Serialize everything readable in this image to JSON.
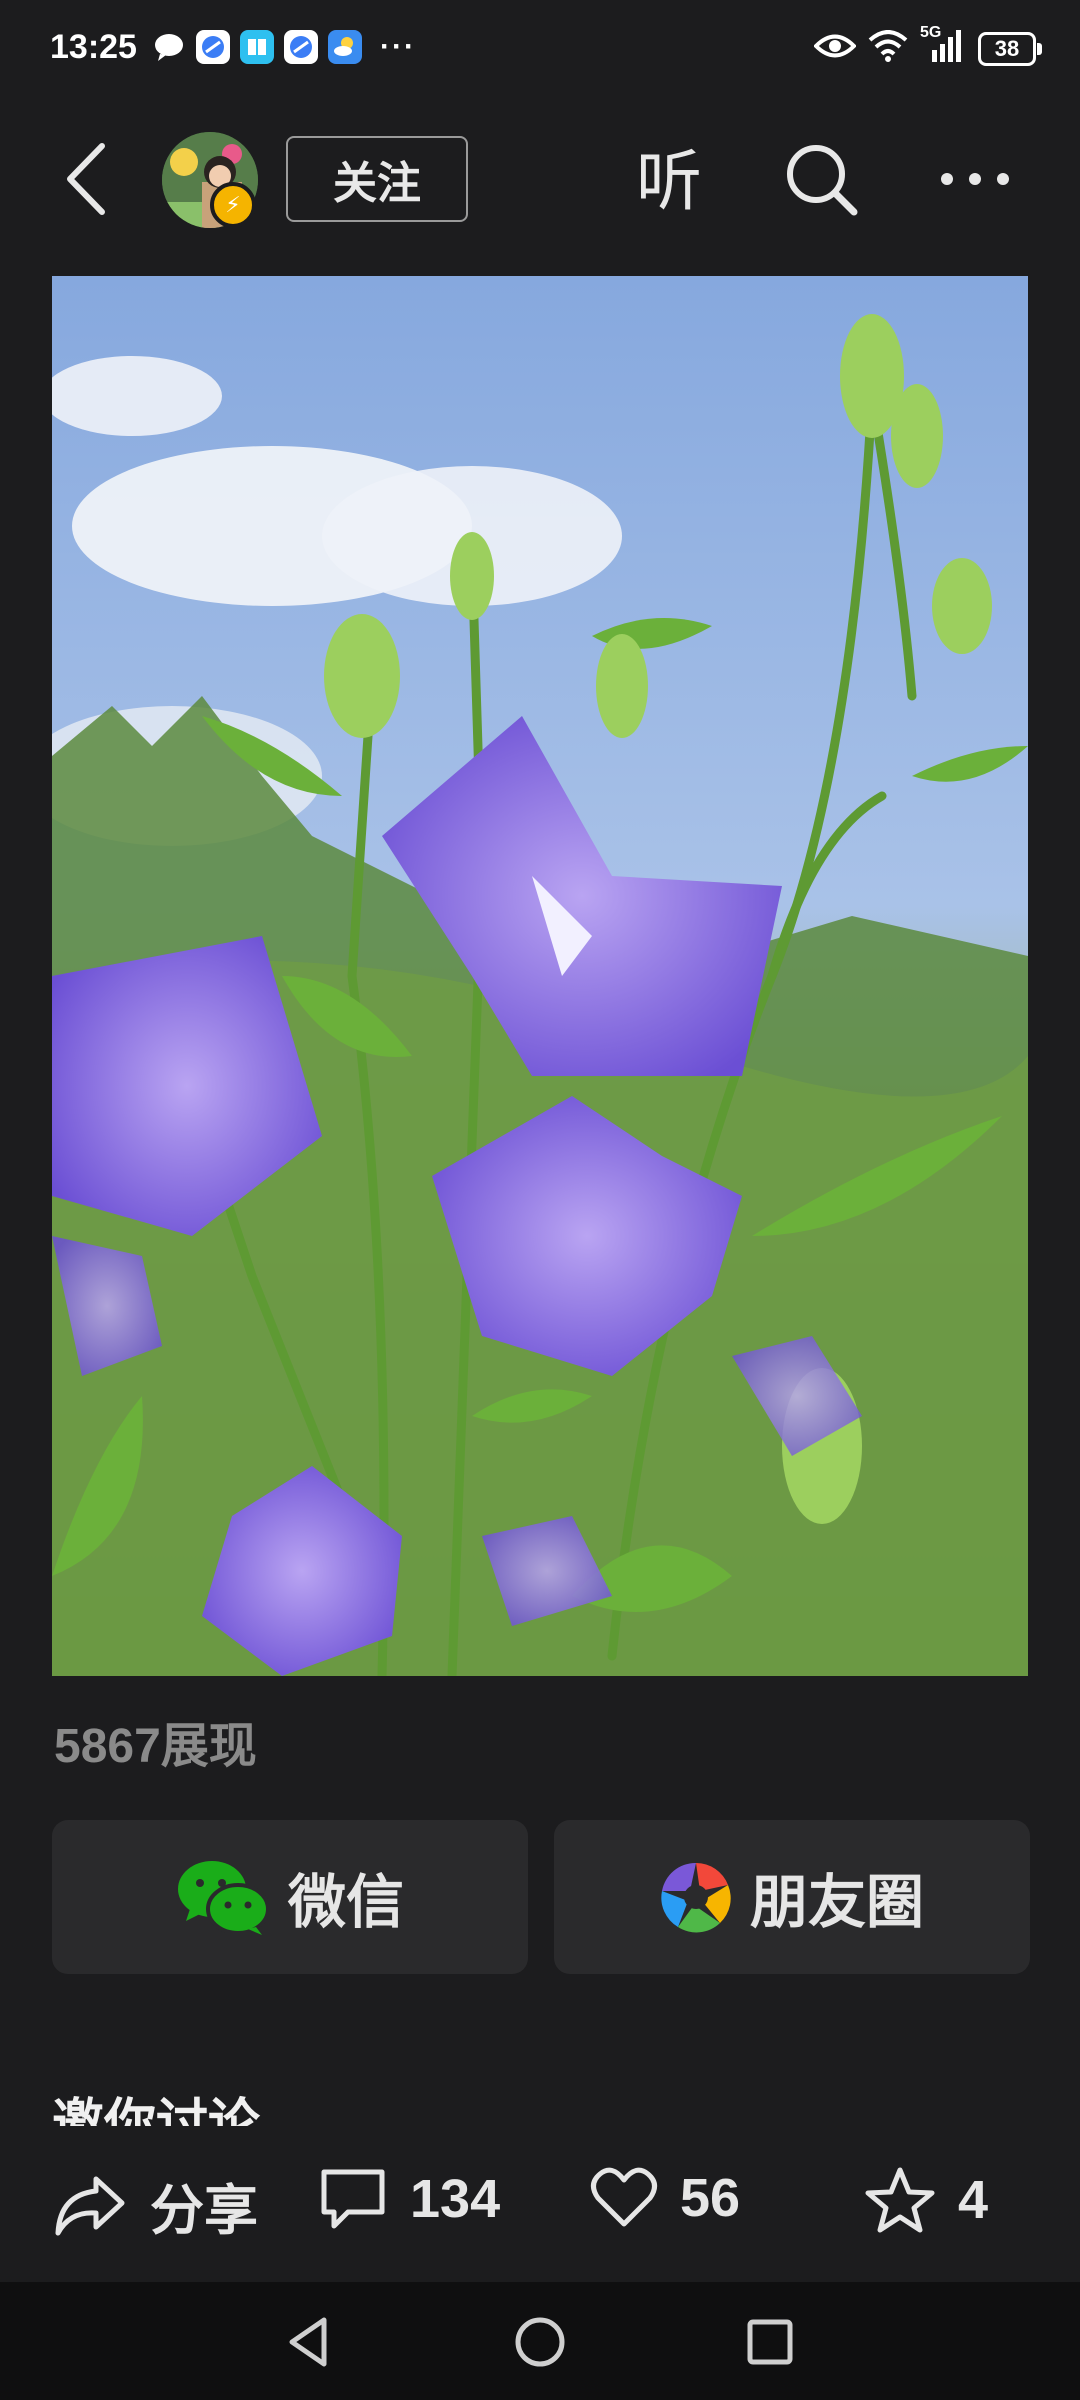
{
  "status_bar": {
    "time": "13:25",
    "dots": "···",
    "network": "5G",
    "battery": "38"
  },
  "header": {
    "follow_label": "关注",
    "listen_label": "听",
    "avatar_badge": "⚡"
  },
  "post": {
    "views": "5867展现"
  },
  "share": {
    "wechat_label": "微信",
    "moments_label": "朋友圈"
  },
  "discussion": {
    "title": "邀你讨论"
  },
  "actions": {
    "share_label": "分享",
    "comment_count": "134",
    "like_count": "56",
    "favorite_count": "4"
  },
  "colors": {
    "background": "#1c1c1e",
    "button_bg": "#2a2a2c",
    "wechat_green": "#1aad19",
    "muted_text": "#8a8a8a"
  }
}
